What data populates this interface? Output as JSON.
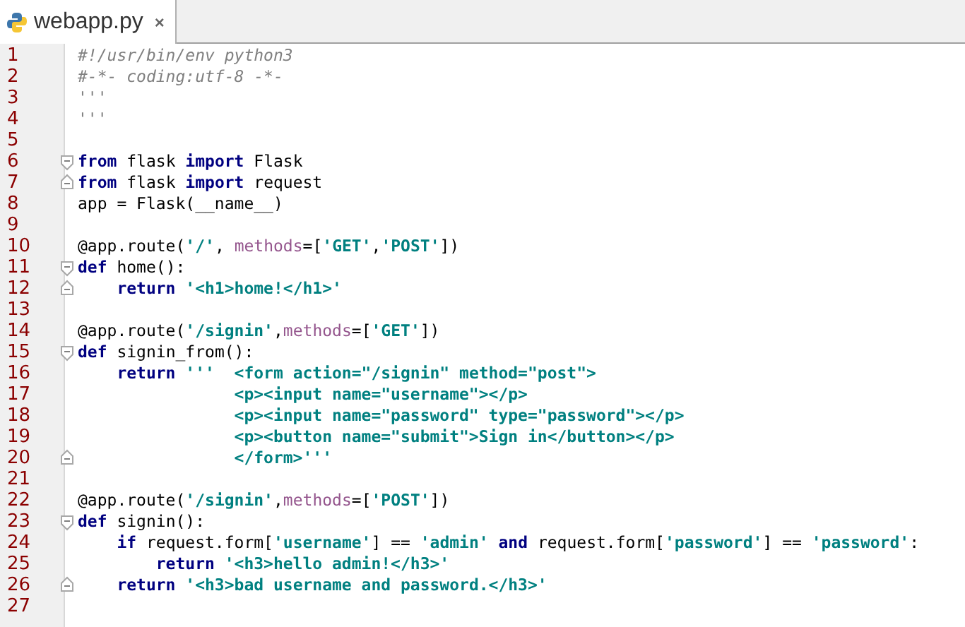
{
  "tabs": [
    {
      "label": "webapp.py",
      "close": "×",
      "selected": true
    }
  ],
  "lines": [
    {
      "number": "1",
      "tokens": [
        {
          "kind": "comment",
          "text": "#!/usr/bin/env python3"
        }
      ]
    },
    {
      "number": "2",
      "tokens": [
        {
          "kind": "comment",
          "text": "#-*- coding:utf-8 -*-"
        }
      ]
    },
    {
      "number": "3",
      "tokens": [
        {
          "kind": "comment",
          "text": "'''"
        }
      ]
    },
    {
      "number": "4",
      "tokens": [
        {
          "kind": "comment",
          "text": "'''"
        }
      ]
    },
    {
      "number": "5"
    },
    {
      "number": "6",
      "fold_start": true,
      "tokens": [
        {
          "kind": "keyword",
          "text": "from"
        },
        {
          "kind": "plain",
          "text": " flask "
        },
        {
          "kind": "keyword",
          "text": "import"
        },
        {
          "kind": "plain",
          "text": " Flask"
        }
      ]
    },
    {
      "number": "7",
      "fold_end": true,
      "tokens": [
        {
          "kind": "keyword",
          "text": "from"
        },
        {
          "kind": "plain",
          "text": " flask "
        },
        {
          "kind": "keyword",
          "text": "import"
        },
        {
          "kind": "plain",
          "text": " request"
        }
      ]
    },
    {
      "number": "8",
      "tokens": [
        {
          "kind": "plain",
          "text": "app = Flask(__name__)"
        }
      ]
    },
    {
      "number": "9"
    },
    {
      "number": "10",
      "tokens": [
        {
          "kind": "plain",
          "text": "@app.route("
        },
        {
          "kind": "string",
          "text": "'/'"
        },
        {
          "kind": "plain",
          "text": ", "
        },
        {
          "kind": "param",
          "text": "methods"
        },
        {
          "kind": "plain",
          "text": "=["
        },
        {
          "kind": "string",
          "text": "'GET'"
        },
        {
          "kind": "plain",
          "text": ","
        },
        {
          "kind": "string",
          "text": "'POST'"
        },
        {
          "kind": "plain",
          "text": "])"
        }
      ]
    },
    {
      "number": "11",
      "fold_start": true,
      "tokens": [
        {
          "kind": "keyword",
          "text": "def"
        },
        {
          "kind": "plain",
          "text": " home():"
        }
      ],
      "children": [
        {
          "number": "12",
          "fold_end": true,
          "tokens": [
            {
              "kind": "keyword",
              "text": "return "
            },
            {
              "kind": "string",
              "text": "'<h1>home!</h1>'"
            }
          ]
        }
      ]
    },
    {
      "number": "13"
    },
    {
      "number": "14",
      "tokens": [
        {
          "kind": "plain",
          "text": "@app.route("
        },
        {
          "kind": "string",
          "text": "'/signin'"
        },
        {
          "kind": "plain",
          "text": ","
        },
        {
          "kind": "param",
          "text": "methods"
        },
        {
          "kind": "plain",
          "text": "=["
        },
        {
          "kind": "string",
          "text": "'GET'"
        },
        {
          "kind": "plain",
          "text": "])"
        }
      ]
    },
    {
      "number": "15",
      "fold_start": true,
      "tokens": [
        {
          "kind": "keyword",
          "text": "def"
        },
        {
          "kind": "plain",
          "text": " signin_from():"
        }
      ],
      "children": [
        {
          "number": "16",
          "tokens": [
            {
              "kind": "keyword",
              "text": "return "
            },
            {
              "kind": "string",
              "text": "'''  <form action=\"/signin\" method=\"post\">"
            }
          ],
          "children": [
            {
              "number": "17",
              "kind": "continuation",
              "tokens": [
                {
                  "kind": "string",
                  "text": "<p><input name=\"username\"></p>"
                }
              ]
            },
            {
              "number": "18",
              "kind": "continuation",
              "tokens": [
                {
                  "kind": "string",
                  "text": "<p><input name=\"password\" type=\"password\"></p>"
                }
              ]
            },
            {
              "number": "19",
              "kind": "continuation",
              "tokens": [
                {
                  "kind": "string",
                  "text": "<p><button name=\"submit\">Sign in</button></p>"
                }
              ]
            },
            {
              "number": "20",
              "kind": "continuation",
              "fold_end": true,
              "tokens": [
                {
                  "kind": "string",
                  "text": "</form>'''"
                }
              ]
            }
          ]
        }
      ]
    },
    {
      "number": "21"
    },
    {
      "number": "22",
      "tokens": [
        {
          "kind": "plain",
          "text": "@app.route("
        },
        {
          "kind": "string",
          "text": "'/signin'"
        },
        {
          "kind": "plain",
          "text": ","
        },
        {
          "kind": "param",
          "text": "methods"
        },
        {
          "kind": "plain",
          "text": "=["
        },
        {
          "kind": "string",
          "text": "'POST'"
        },
        {
          "kind": "plain",
          "text": "])"
        }
      ]
    },
    {
      "number": "23",
      "fold_start": true,
      "tokens": [
        {
          "kind": "keyword",
          "text": "def"
        },
        {
          "kind": "plain",
          "text": " signin():"
        }
      ],
      "children": [
        {
          "number": "24",
          "tokens": [
            {
              "kind": "keyword",
              "text": "if"
            },
            {
              "kind": "plain",
              "text": " request.form["
            },
            {
              "kind": "string",
              "text": "'username'"
            },
            {
              "kind": "plain",
              "text": "] == "
            },
            {
              "kind": "string",
              "text": "'admin'"
            },
            {
              "kind": "keyword",
              "text": " and"
            },
            {
              "kind": "plain",
              "text": " request.form["
            },
            {
              "kind": "string",
              "text": "'password'"
            },
            {
              "kind": "plain",
              "text": "] == "
            },
            {
              "kind": "string",
              "text": "'password'"
            },
            {
              "kind": "plain",
              "text": ":"
            }
          ],
          "children": [
            {
              "number": "25",
              "tokens": [
                {
                  "kind": "keyword",
                  "text": "return "
                },
                {
                  "kind": "string",
                  "text": "'<h3>hello admin!</h3>'"
                }
              ]
            }
          ]
        },
        {
          "number": "26",
          "fold_end": true,
          "tokens": [
            {
              "kind": "keyword",
              "text": "return "
            },
            {
              "kind": "string",
              "text": "'<h3>bad username and password.</h3>'"
            }
          ]
        }
      ]
    },
    {
      "number": "27"
    }
  ]
}
